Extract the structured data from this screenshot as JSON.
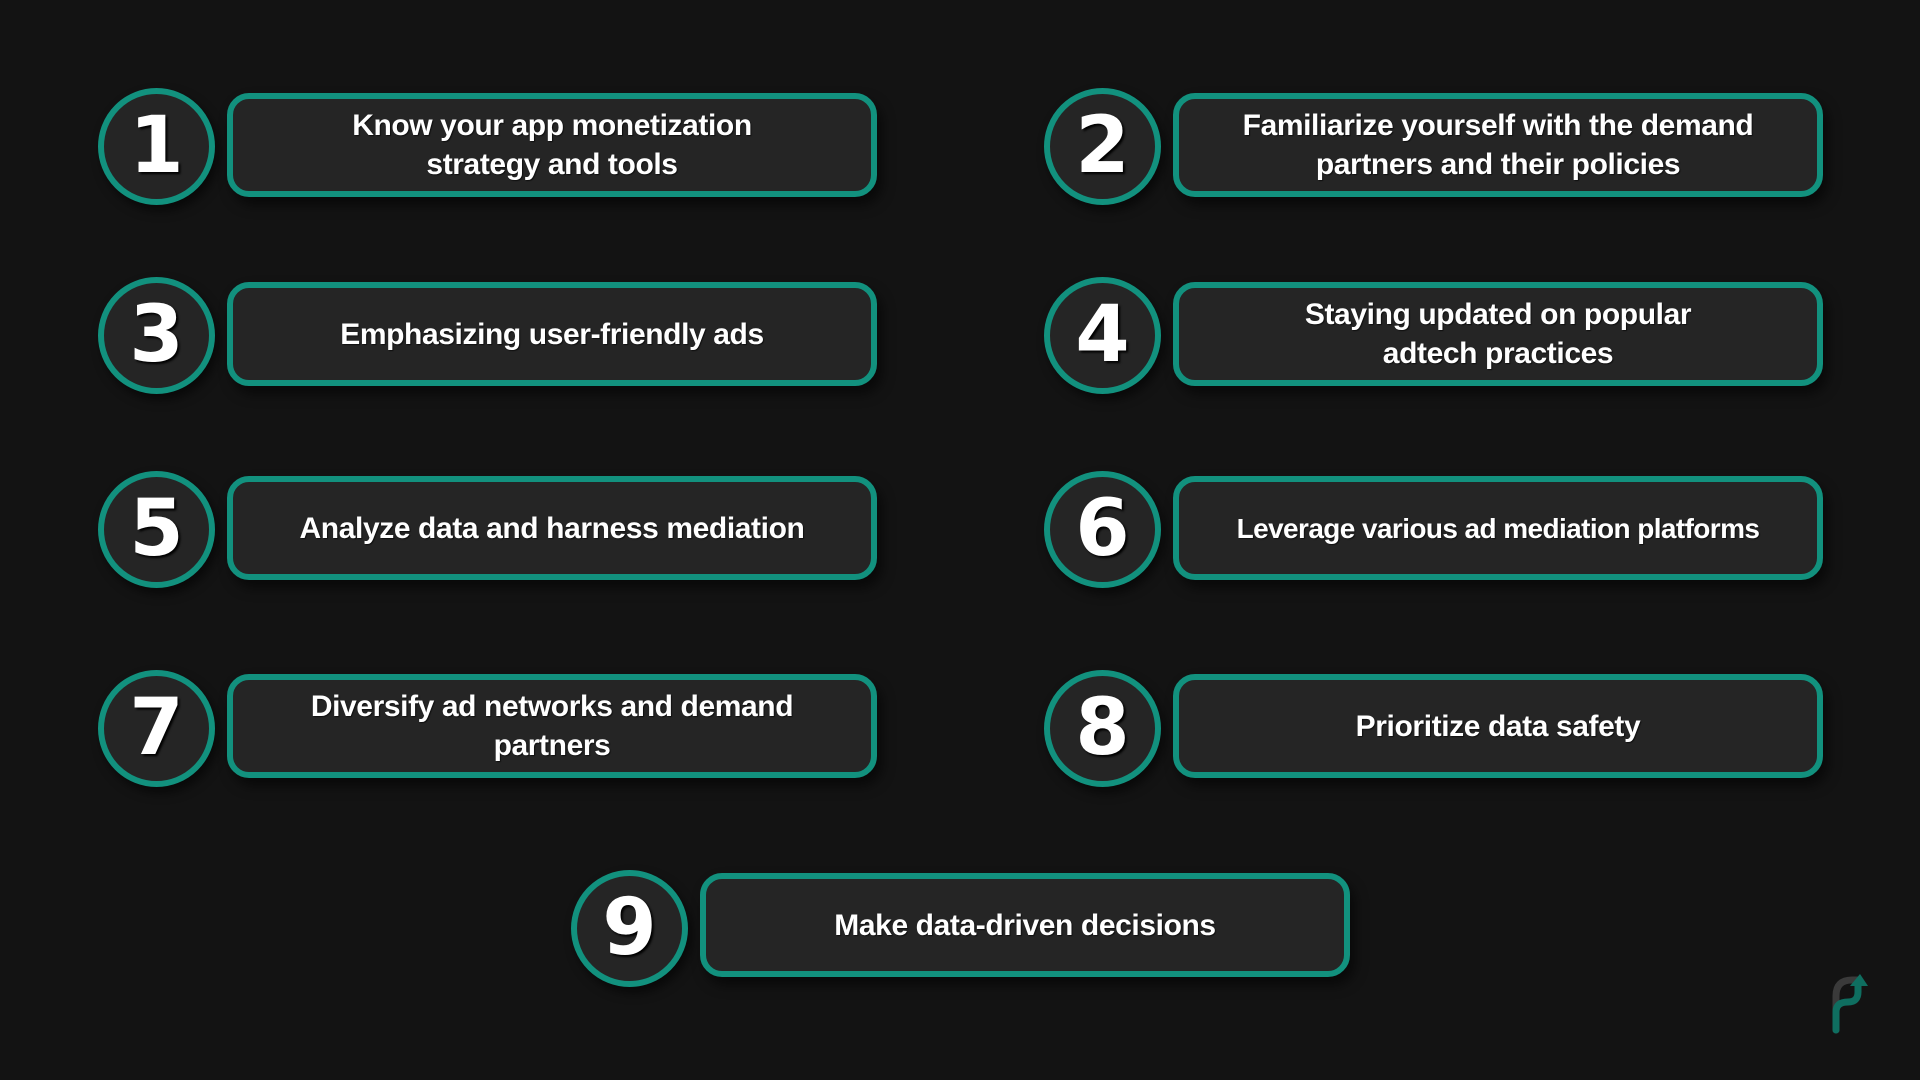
{
  "colors": {
    "background": "#131313",
    "box_fill": "#252525",
    "accent": "#12917e",
    "text": "#ffffff"
  },
  "steps": [
    {
      "number": "1",
      "text": "Know your app monetization strategy and tools"
    },
    {
      "number": "2",
      "text": "Familiarize yourself with the demand partners and their policies"
    },
    {
      "number": "3",
      "text": "Emphasizing user-friendly ads"
    },
    {
      "number": "4",
      "text": "Staying updated on popular adtech practices"
    },
    {
      "number": "5",
      "text": "Analyze data and harness mediation"
    },
    {
      "number": "6",
      "text": "Leverage various ad mediation platforms"
    },
    {
      "number": "7",
      "text": "Diversify ad networks and demand partners"
    },
    {
      "number": "8",
      "text": "Prioritize data safety"
    },
    {
      "number": "9",
      "text": "Make data-driven decisions"
    }
  ],
  "logo": {
    "icon": "brand-p-arrow-logo"
  }
}
